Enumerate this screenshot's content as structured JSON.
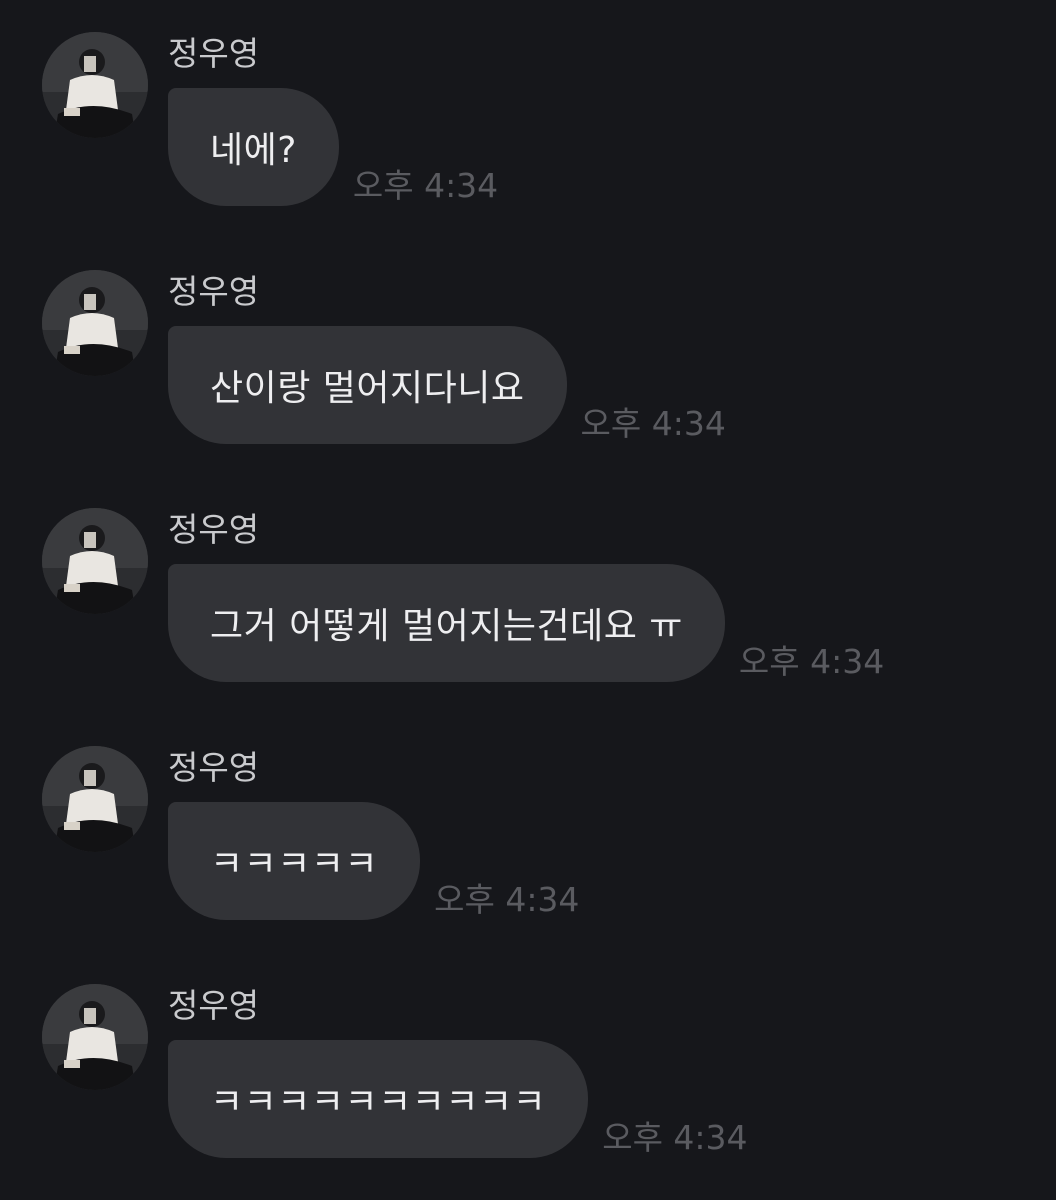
{
  "messages": [
    {
      "sender": "정우영",
      "text": "네에?",
      "time": "오후 4:34"
    },
    {
      "sender": "정우영",
      "text": "산이랑 멀어지다니요",
      "time": "오후 4:34"
    },
    {
      "sender": "정우영",
      "text": "그거 어떻게 멀어지는건데요 ㅠ",
      "time": "오후 4:34"
    },
    {
      "sender": "정우영",
      "text": "ㅋㅋㅋㅋㅋ",
      "time": "오후 4:34"
    },
    {
      "sender": "정우영",
      "text": "ㅋㅋㅋㅋㅋㅋㅋㅋㅋㅋ",
      "time": "오후 4:34"
    }
  ],
  "avatar_icon": "profile-photo-icon",
  "colors": {
    "background": "#16171b",
    "bubble": "#323337",
    "sender_text": "#c9cacd",
    "message_text": "#eeeef0",
    "timestamp": "#5a5b60"
  }
}
